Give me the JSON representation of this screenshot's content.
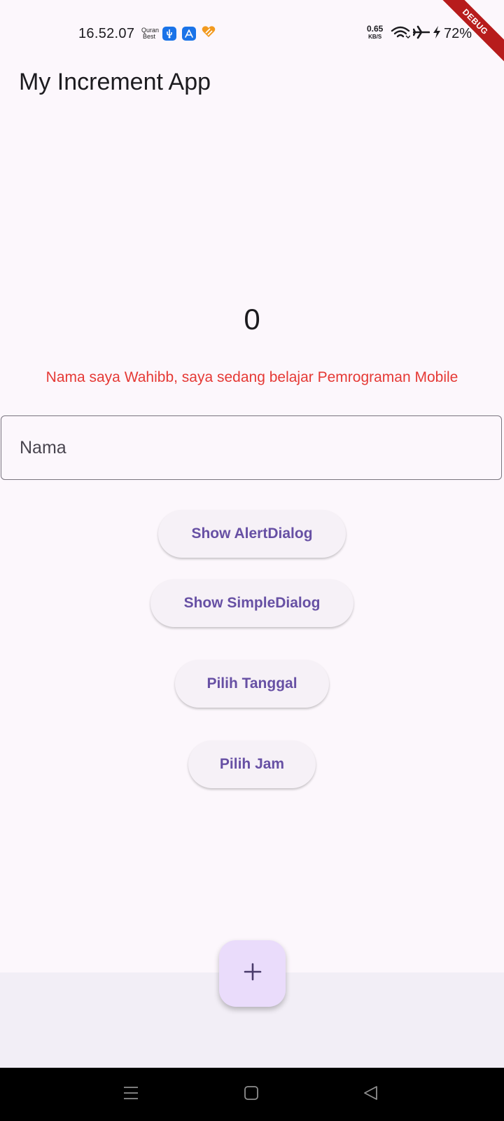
{
  "status_bar": {
    "time": "16.52.07",
    "quran_line1": "Quran",
    "quran_line2": "Best",
    "net_speed_value": "0.65",
    "net_speed_unit": "KB/S",
    "battery": "72%"
  },
  "debug_banner": "DEBUG",
  "app_bar": {
    "title": "My Increment App"
  },
  "main": {
    "counter": "0",
    "intro_text": "Nama saya Wahibb, saya sedang belajar Pemrograman Mobile",
    "name_field": {
      "placeholder": "Nama",
      "value": ""
    },
    "buttons": {
      "alert_dialog": "Show AlertDialog",
      "simple_dialog": "Show SimpleDialog",
      "pick_date": "Pilih Tanggal",
      "pick_time": "Pilih Jam"
    }
  },
  "fab": {
    "icon": "add-icon"
  },
  "colors": {
    "background": "#fcf7fc",
    "accent": "#6750a4",
    "intro_text": "#e53935",
    "fab": "#eadcfb",
    "debug_banner": "#b71c1c"
  },
  "navigation": {
    "icons": [
      "menu-icon",
      "home-icon",
      "back-icon"
    ]
  }
}
